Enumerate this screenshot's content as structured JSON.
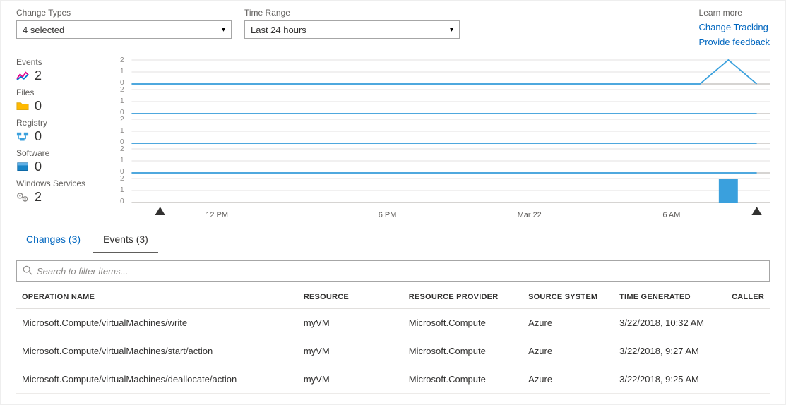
{
  "filters": {
    "change_types": {
      "label": "Change Types",
      "value": "4 selected"
    },
    "time_range": {
      "label": "Time Range",
      "value": "Last 24 hours"
    }
  },
  "learn_more": {
    "heading": "Learn more",
    "links": [
      {
        "label": "Change Tracking"
      },
      {
        "label": "Provide feedback"
      }
    ]
  },
  "counters": [
    {
      "name": "Events",
      "value": 2,
      "icon": "chart-icon"
    },
    {
      "name": "Files",
      "value": 0,
      "icon": "folder-icon"
    },
    {
      "name": "Registry",
      "value": 0,
      "icon": "registry-icon"
    },
    {
      "name": "Software",
      "value": 0,
      "icon": "package-icon"
    },
    {
      "name": "Windows Services",
      "value": 2,
      "icon": "gears-icon"
    }
  ],
  "chart_data": [
    {
      "name": "Events",
      "type": "line",
      "ylim": [
        0,
        2
      ],
      "yTicks": [
        0,
        1,
        2
      ],
      "x": [
        "12 PM",
        "6 PM",
        "Mar 22",
        "6 AM"
      ],
      "values": [
        0,
        0,
        0,
        0,
        0,
        0,
        0,
        0,
        0,
        0,
        0,
        0,
        0,
        0,
        0,
        0,
        0,
        0,
        0,
        0,
        0,
        2,
        0
      ]
    },
    {
      "name": "Files",
      "type": "line",
      "ylim": [
        0,
        2
      ],
      "yTicks": [
        0,
        1,
        2
      ],
      "x": [
        "12 PM",
        "6 PM",
        "Mar 22",
        "6 AM"
      ],
      "values": [
        0,
        0,
        0,
        0,
        0,
        0,
        0,
        0,
        0,
        0,
        0,
        0,
        0,
        0,
        0,
        0,
        0,
        0,
        0,
        0,
        0,
        0,
        0
      ]
    },
    {
      "name": "Registry",
      "type": "line",
      "ylim": [
        0,
        2
      ],
      "yTicks": [
        0,
        1,
        2
      ],
      "x": [
        "12 PM",
        "6 PM",
        "Mar 22",
        "6 AM"
      ],
      "values": [
        0,
        0,
        0,
        0,
        0,
        0,
        0,
        0,
        0,
        0,
        0,
        0,
        0,
        0,
        0,
        0,
        0,
        0,
        0,
        0,
        0,
        0,
        0
      ]
    },
    {
      "name": "Software",
      "type": "line",
      "ylim": [
        0,
        2
      ],
      "yTicks": [
        0,
        1,
        2
      ],
      "x": [
        "12 PM",
        "6 PM",
        "Mar 22",
        "6 AM"
      ],
      "values": [
        0,
        0,
        0,
        0,
        0,
        0,
        0,
        0,
        0,
        0,
        0,
        0,
        0,
        0,
        0,
        0,
        0,
        0,
        0,
        0,
        0,
        0,
        0
      ]
    },
    {
      "name": "Windows Services",
      "type": "bar",
      "ylim": [
        0,
        2
      ],
      "yTicks": [
        0,
        1,
        2
      ],
      "x": [
        "12 PM",
        "6 PM",
        "Mar 22",
        "6 AM"
      ],
      "values": [
        0,
        0,
        0,
        0,
        0,
        0,
        0,
        0,
        0,
        0,
        0,
        0,
        0,
        0,
        0,
        0,
        0,
        0,
        0,
        0,
        0,
        2,
        0
      ]
    }
  ],
  "xaxis": {
    "labels": [
      "12 PM",
      "6 PM",
      "Mar 22",
      "6 AM"
    ],
    "marker_left_index": 1,
    "marker_right_index": 22
  },
  "tabs": [
    {
      "label": "Changes (3)",
      "active": false
    },
    {
      "label": "Events (3)",
      "active": true
    }
  ],
  "search": {
    "placeholder": "Search to filter items..."
  },
  "table": {
    "columns": [
      "OPERATION NAME",
      "RESOURCE",
      "RESOURCE PROVIDER",
      "SOURCE SYSTEM",
      "TIME GENERATED",
      "CALLER"
    ],
    "rows": [
      {
        "op": "Microsoft.Compute/virtualMachines/write",
        "res": "myVM",
        "prov": "Microsoft.Compute",
        "src": "Azure",
        "time": "3/22/2018, 10:32 AM",
        "caller": ""
      },
      {
        "op": "Microsoft.Compute/virtualMachines/start/action",
        "res": "myVM",
        "prov": "Microsoft.Compute",
        "src": "Azure",
        "time": "3/22/2018, 9:27 AM",
        "caller": ""
      },
      {
        "op": "Microsoft.Compute/virtualMachines/deallocate/action",
        "res": "myVM",
        "prov": "Microsoft.Compute",
        "src": "Azure",
        "time": "3/22/2018, 9:25 AM",
        "caller": ""
      }
    ]
  },
  "colors": {
    "accent": "#3aa0dd",
    "axis": "#8a8886",
    "link": "#0066bf"
  }
}
